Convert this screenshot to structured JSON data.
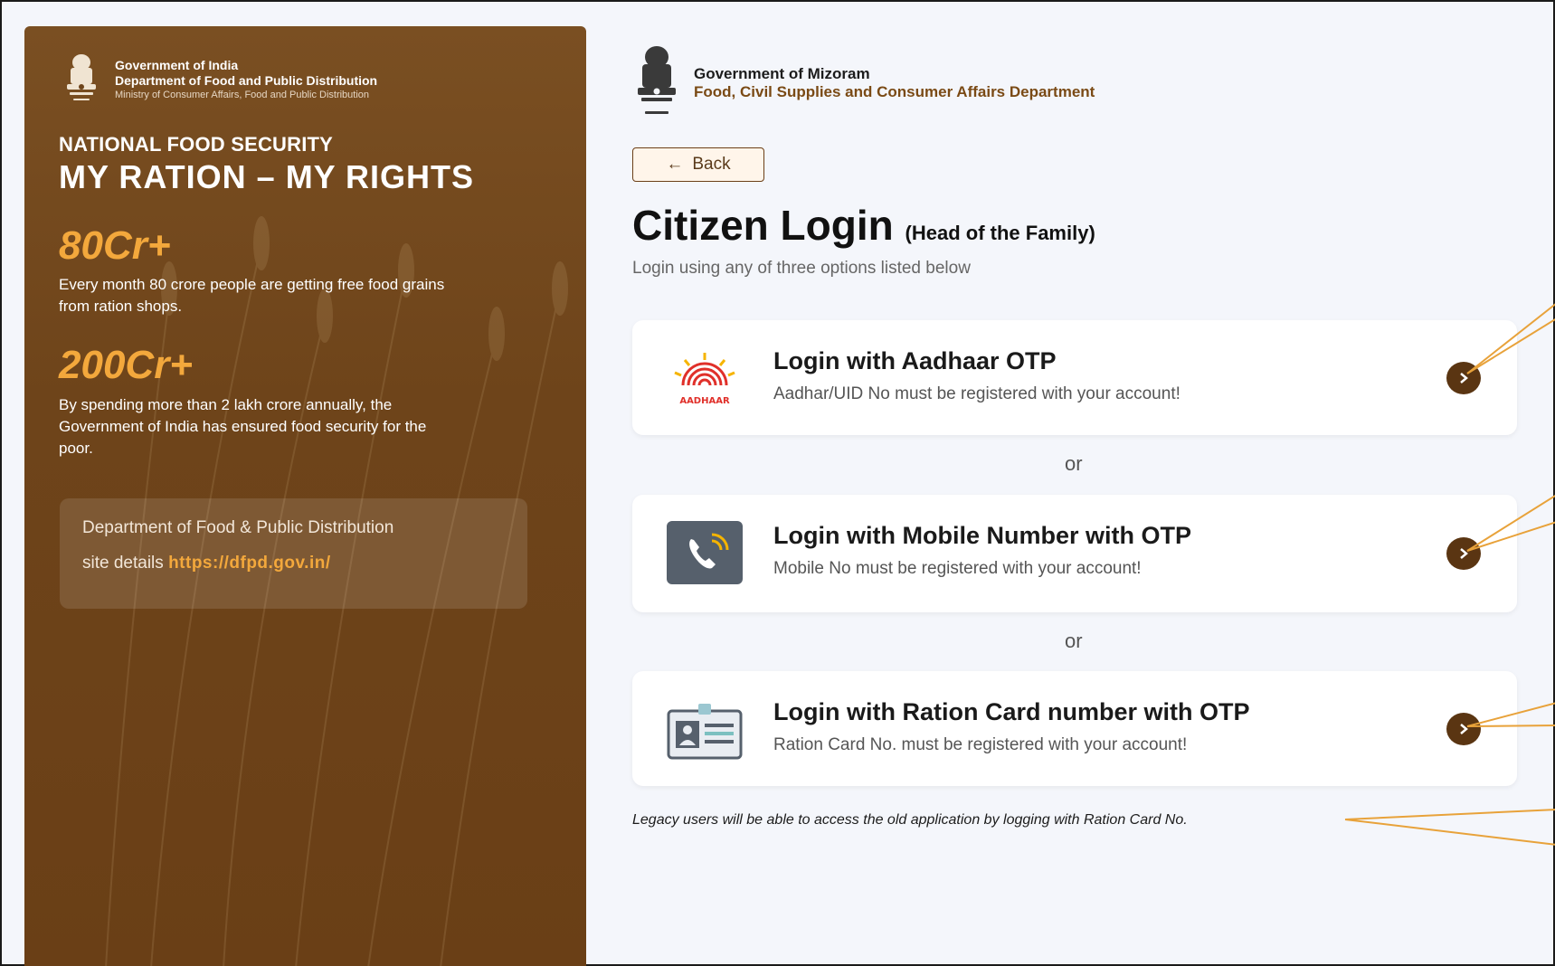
{
  "left_panel": {
    "gov_line1": "Government of India",
    "gov_line2": "Department of Food and Public Distribution",
    "gov_line3": "Ministry of Consumer Affairs, Food and Public Distribution",
    "nfs_title": "NATIONAL FOOD SECURITY",
    "tagline": "MY RATION – MY RIGHTS",
    "stats": [
      {
        "value": "80Cr+",
        "desc": "Every month 80 crore people are getting free food grains from ration shops."
      },
      {
        "value": "200Cr+",
        "desc": "By spending more than 2 lakh crore annually, the Government of India has ensured food security for the poor."
      }
    ],
    "dept_box": {
      "line1": "Department of Food & Public Distribution",
      "line2_prefix": "site details",
      "link": "https://dfpd.gov.in/"
    }
  },
  "header": {
    "line1": "Government of Mizoram",
    "line2": "Food, Civil Supplies and Consumer Affairs Department"
  },
  "back_label": "Back",
  "title": "Citizen Login",
  "title_suffix": "(Head of the Family)",
  "subtitle": "Login using any of three options listed below",
  "options": [
    {
      "title": "Login with Aadhaar OTP",
      "desc": "Aadhar/UID No must be registered with your account!",
      "icon": "aadhaar-logo-icon"
    },
    {
      "title": "Login with Mobile Number with OTP",
      "desc": "Mobile No must be registered with your account!",
      "icon": "phone-icon"
    },
    {
      "title": "Login with Ration Card number with OTP",
      "desc": "Ration Card No. must be registered with your account!",
      "icon": "id-card-icon"
    }
  ],
  "or_label": "or",
  "legacy_note": "Legacy users will be able to access the old application by logging with Ration Card No.",
  "colors": {
    "panel_brown": "#6e441a",
    "accent_orange": "#f3a83c",
    "arrow_brown": "#5a3512",
    "callout_line": "#e8a23a"
  }
}
